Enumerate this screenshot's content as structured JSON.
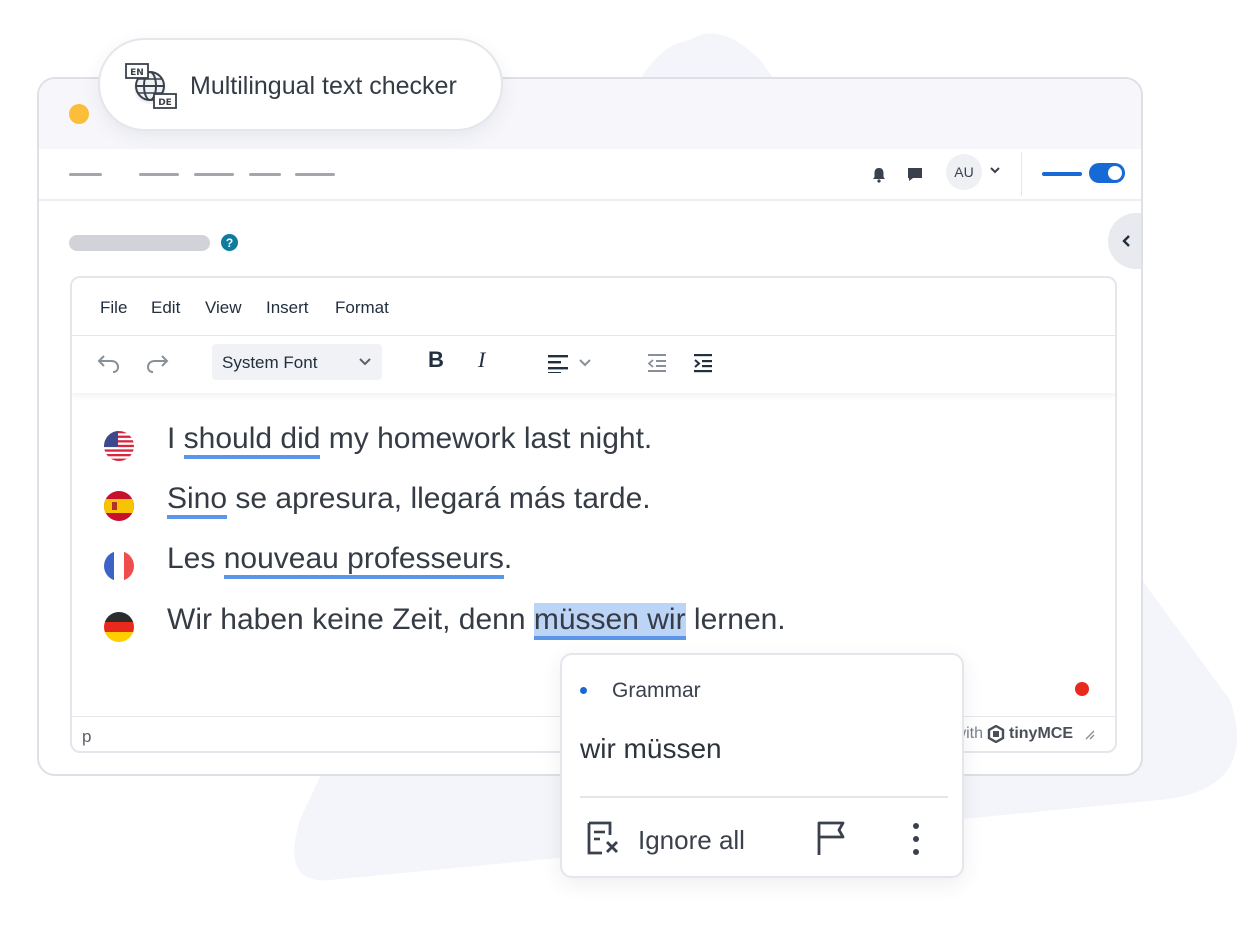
{
  "badge": {
    "title": "Multilingual text checker",
    "icon": "translate-globe-icon",
    "icon_top": "EN",
    "icon_bottom": "DE"
  },
  "window": {
    "dot_color": "#fbbd3a"
  },
  "appbar": {
    "avatar": "AU",
    "toggle_state": "on"
  },
  "help": "?",
  "editor": {
    "menu": [
      "File",
      "Edit",
      "View",
      "Insert",
      "Format"
    ],
    "font_select": "System Font",
    "status_path": "p",
    "brand_prefix": "with",
    "brand_name": "tinyMCE"
  },
  "lines": [
    {
      "flag": "us-flag-icon",
      "pre": "I ",
      "err": "should did",
      "post": " my homework last night."
    },
    {
      "flag": "es-flag-icon",
      "pre": "",
      "err": "Sino",
      "post": " se apresura, llegará más tarde."
    },
    {
      "flag": "fr-flag-icon",
      "pre": "Les ",
      "err": "nouveau professeurs",
      "post": "."
    },
    {
      "flag": "de-flag-icon",
      "pre": "Wir haben keine Zeit, denn ",
      "err": "müssen wir",
      "post": " lernen."
    }
  ],
  "popup": {
    "category": "Grammar",
    "suggestion": "wir müssen",
    "ignore_label": "Ignore all"
  },
  "colors": {
    "accent": "#1769d6",
    "underline": "#5b96e8",
    "error_dot": "#e8291c"
  }
}
